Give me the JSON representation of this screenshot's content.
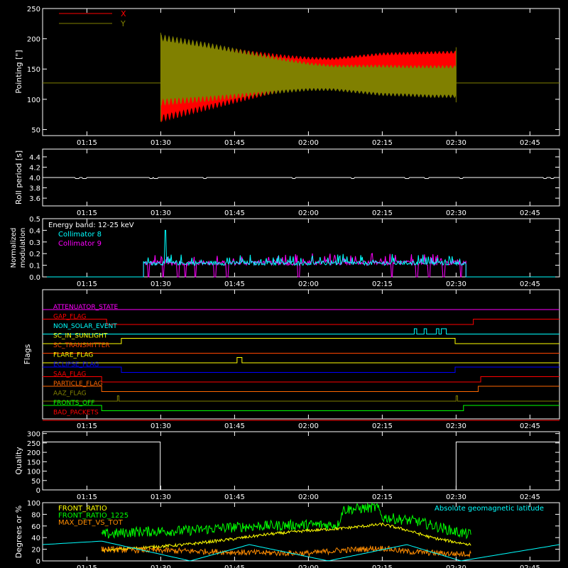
{
  "figure": {
    "background": "#000000",
    "foreground": "#ffffff",
    "time_ticks": [
      "01:15",
      "01:30",
      "01:45",
      "02:00",
      "02:15",
      "02:30",
      "02:45"
    ],
    "time_tick_minutes": [
      75,
      90,
      105,
      120,
      135,
      150,
      165
    ],
    "xlim_minutes": [
      66,
      171
    ]
  },
  "chart_data": [
    {
      "id": "pointing",
      "type": "area",
      "ylabel": "Pointing [\"]",
      "ylim": [
        40,
        250
      ],
      "yticks": [
        50,
        100,
        150,
        200,
        250
      ],
      "legend": [
        {
          "name": "X",
          "color": "#ff0000"
        },
        {
          "name": "Y",
          "color": "#808000"
        }
      ],
      "baseline_y": 127,
      "series": [
        {
          "name": "X",
          "color": "#ff0000",
          "x": [
            90,
            95,
            100,
            105,
            110,
            115,
            120,
            125,
            130,
            135,
            140,
            145,
            150
          ],
          "center": [
            127,
            130,
            133,
            137,
            140,
            143,
            146,
            149,
            151,
            153,
            154,
            155,
            156
          ],
          "amplitude": [
            62,
            55,
            48,
            42,
            35,
            28,
            22,
            18,
            20,
            22,
            22,
            22,
            22
          ]
        },
        {
          "name": "Y",
          "color": "#808000",
          "x": [
            90,
            95,
            100,
            105,
            110,
            115,
            120,
            125,
            130,
            135,
            140,
            145,
            150
          ],
          "center": [
            150,
            148,
            146,
            144,
            142,
            140,
            138,
            136,
            134,
            132,
            131,
            130,
            130
          ],
          "amplitude": [
            55,
            50,
            45,
            39,
            33,
            27,
            22,
            20,
            22,
            24,
            24,
            25,
            25
          ]
        }
      ],
      "active_range": [
        90,
        150
      ]
    },
    {
      "id": "roll",
      "type": "line",
      "ylabel": "Roll period [s]",
      "ylim": [
        3.45,
        4.55
      ],
      "yticks": [
        3.6,
        3.8,
        4.0,
        4.2,
        4.4
      ],
      "series": [
        {
          "name": "roll",
          "color": "#ffffff",
          "value": 4.0,
          "dips_x": [
            73,
            74.5,
            88,
            89,
            99,
            117,
            129,
            140,
            144,
            151,
            168,
            169.5
          ],
          "dip_depth": 0.02
        }
      ]
    },
    {
      "id": "modulation",
      "type": "line",
      "ylabel": [
        "Normalized",
        "modulation"
      ],
      "ylim": [
        0,
        0.5
      ],
      "yticks": [
        0.0,
        0.1,
        0.2,
        0.3,
        0.4,
        0.5
      ],
      "annotation": "Energy band: 12-25 keV",
      "legend": [
        {
          "name": "Collimator 8",
          "color": "#00ffff"
        },
        {
          "name": "Collimator 9",
          "color": "#ff00ff"
        }
      ],
      "active_range": [
        86.5,
        152
      ],
      "baseline": 0.1,
      "noise_max": 0.11,
      "spike": {
        "x": 91,
        "y": 0.4
      },
      "dip_x_collimator9": [
        87.5,
        90.5,
        93.5,
        95,
        97,
        101,
        103.5,
        118,
        137,
        142,
        144.5,
        147.5,
        151
      ]
    },
    {
      "id": "flags",
      "type": "table",
      "ylabel": "Flags",
      "rows": [
        {
          "name": "ATTENUATOR_STATE",
          "color": "#ff00ff",
          "segments": [
            [
              66,
              171,
              0
            ]
          ]
        },
        {
          "name": "GAP_FLAG",
          "color": "#ff0000",
          "segments": [
            [
              66,
              79,
              0
            ],
            [
              79,
              153.5,
              -1
            ],
            [
              153.5,
              171,
              0
            ]
          ]
        },
        {
          "name": "NON_SOLAR_EVENT",
          "color": "#00ffff",
          "pulses": [
            [
              141.5,
              142
            ],
            [
              143.5,
              144
            ],
            [
              146,
              146.5
            ],
            [
              147,
              148
            ]
          ]
        },
        {
          "name": "SC_IN_SUNLIGHT",
          "color": "#ffff00",
          "segments": [
            [
              66,
              82,
              -1
            ],
            [
              82,
              149.8,
              0
            ],
            [
              149.8,
              171,
              -1
            ]
          ]
        },
        {
          "name": "SC_TRANSMITTER",
          "color": "#ff4500",
          "segments": [
            [
              66,
              171,
              -1
            ]
          ]
        },
        {
          "name": "FLARE_FLAG",
          "color": "#ffff00",
          "pulses": [
            [
              105.5,
              106.5
            ]
          ]
        },
        {
          "name": "ECLIPSE_FLAG",
          "color": "#0000ff",
          "segments": [
            [
              66,
              82,
              0
            ],
            [
              82,
              149.8,
              -1
            ],
            [
              149.8,
              171,
              0
            ]
          ]
        },
        {
          "name": "SAA_FLAG",
          "color": "#ff0000",
          "segments": [
            [
              66,
              78,
              0
            ],
            [
              78,
              155,
              -1
            ],
            [
              155,
              171,
              0
            ]
          ]
        },
        {
          "name": "PARTICLE_FLAG",
          "color": "#ff6600",
          "segments": [
            [
              66,
              78,
              0
            ],
            [
              78,
              154.5,
              -1
            ],
            [
              154.5,
              171,
              0
            ]
          ]
        },
        {
          "name": "AAZ_FLAG",
          "color": "#808000",
          "pulses": [
            [
              81.2,
              81.5
            ],
            [
              150,
              150.3
            ]
          ]
        },
        {
          "name": "FRONTS_OFF",
          "color": "#00ff00",
          "segments": [
            [
              66,
              78,
              0
            ],
            [
              78,
              151.5,
              -1
            ],
            [
              151.5,
              171,
              0
            ]
          ]
        },
        {
          "name": "BAD_PACKETS",
          "color": "#ff0000",
          "segments": [
            [
              66,
              171,
              -1
            ]
          ]
        }
      ]
    },
    {
      "id": "quality",
      "type": "line",
      "ylabel": "Quality",
      "ylim": [
        0,
        310
      ],
      "yticks": [
        0,
        50,
        100,
        150,
        200,
        250,
        300
      ],
      "series": [
        {
          "name": "quality",
          "color": "#ffffff",
          "x": [
            66,
            89.9,
            89.9,
            150,
            150,
            171
          ],
          "y": [
            255,
            255,
            0,
            0,
            255,
            255
          ]
        }
      ]
    },
    {
      "id": "ratios",
      "type": "line",
      "ylabel": "Degrees or %",
      "ylim": [
        0,
        100
      ],
      "yticks": [
        0,
        20,
        40,
        60,
        80,
        100
      ],
      "legend": [
        {
          "name": "FRONT_RATIO",
          "color": "#ffff00"
        },
        {
          "name": "FRONT_RATIO_1225",
          "color": "#00ff00"
        },
        {
          "name": "MAX_DET_VS_TOT",
          "color": "#ff8c00"
        }
      ],
      "legend_right": {
        "name": "Absolute geomagnetic latitude",
        "color": "#00ffff"
      },
      "active_range": [
        78,
        153
      ],
      "series": [
        {
          "name": "FRONT_RATIO_1225",
          "color": "#00ff00",
          "noise": 9,
          "x": [
            78,
            85,
            95,
            105,
            110,
            120,
            126,
            127,
            134,
            135,
            142,
            150,
            153
          ],
          "y": [
            45,
            50,
            52,
            58,
            60,
            62,
            62,
            88,
            92,
            75,
            68,
            50,
            45
          ]
        },
        {
          "name": "FRONT_RATIO",
          "color": "#ffff00",
          "noise": 2.5,
          "x": [
            78,
            85,
            95,
            105,
            112,
            120,
            127,
            135,
            140,
            145,
            150,
            153
          ],
          "y": [
            18,
            22,
            28,
            38,
            46,
            52,
            56,
            63,
            53,
            40,
            32,
            28
          ]
        },
        {
          "name": "MAX_DET_VS_TOT",
          "color": "#ff8c00",
          "noise": 5,
          "x": [
            78,
            90,
            100,
            110,
            120,
            126,
            135,
            140,
            150,
            153
          ],
          "y": [
            20,
            18,
            16,
            14,
            13,
            18,
            22,
            16,
            12,
            12
          ]
        },
        {
          "name": "Absolute geomagnetic latitude",
          "color": "#00ffff",
          "noise": 0,
          "x": [
            66,
            78,
            96,
            108,
            124,
            140,
            151,
            171
          ],
          "y": [
            28,
            34,
            0,
            28,
            0,
            28,
            0,
            28
          ]
        }
      ]
    }
  ]
}
